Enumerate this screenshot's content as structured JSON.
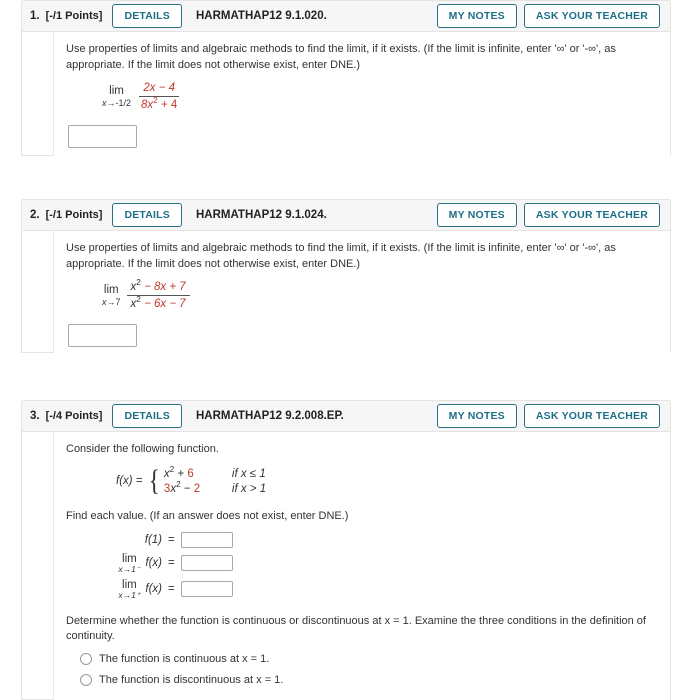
{
  "accent_color": "#1d6f87",
  "math_highlight_color": "#c0392b",
  "header_bg": "#f6f6f6",
  "buttons": {
    "details": "DETAILS",
    "my_notes": "MY NOTES",
    "ask_your_teacher": "ASK YOUR TEACHER"
  },
  "questions": [
    {
      "number": "1.",
      "points": "[-/1 Points]",
      "code": "HARMATHAP12 9.1.020.",
      "prompt": "Use properties of limits and algebraic methods to find the limit, if it exists. (If the limit is infinite, enter '∞' or '-∞', as appropriate. If the limit does not otherwise exist, enter DNE.)",
      "math": {
        "lim_label": "lim",
        "lim_sub_var": "x",
        "lim_sub_arrow": "→",
        "lim_sub_value": "-1/2",
        "numerator": "2x − 4",
        "denominator_base": "8x",
        "denominator_exp": "2",
        "denominator_rest": " + 4"
      },
      "answer_value": ""
    },
    {
      "number": "2.",
      "points": "[-/1 Points]",
      "code": "HARMATHAP12 9.1.024.",
      "prompt": "Use properties of limits and algebraic methods to find the limit, if it exists. (If the limit is infinite, enter '∞' or '-∞', as appropriate. If the limit does not otherwise exist, enter DNE.)",
      "math": {
        "lim_label": "lim",
        "lim_sub_var": "x",
        "lim_sub_arrow": "→",
        "lim_sub_value": "7",
        "num_base": "x",
        "num_exp": "2",
        "num_rest": " − 8x + 7",
        "den_base": "x",
        "den_exp": "2",
        "den_rest": " − 6x − 7"
      },
      "answer_value": ""
    },
    {
      "number": "3.",
      "points": "[-/4 Points]",
      "code": "HARMATHAP12 9.2.008.EP.",
      "prompt": "Consider the following function.",
      "piecewise": {
        "fx": "f(x)  =",
        "case1_expr_base": "x",
        "case1_expr_exp": "2",
        "case1_expr_rest": " + ",
        "case1_expr_red": "6",
        "case1_cond": "if x ≤ 1",
        "case2_coef": "3",
        "case2_base": "x",
        "case2_exp": "2",
        "case2_minus": " − ",
        "case2_const": "2",
        "case2_cond": "if x > 1"
      },
      "find_prompt": "Find each value. (If an answer does not exist, enter DNE.)",
      "value_rows": [
        {
          "label_type": "plain",
          "label": "f(1)",
          "value": ""
        },
        {
          "label_type": "limit",
          "lim": "lim",
          "sub": "x→1⁻",
          "fn": "f(x)",
          "value": ""
        },
        {
          "label_type": "limit",
          "lim": "lim",
          "sub": "x→1⁺",
          "fn": "f(x)",
          "value": ""
        }
      ],
      "continuity_prompt": "Determine whether the function is continuous or discontinuous at x = 1. Examine the three conditions in the definition of continuity.",
      "options": [
        "The function is continuous at x = 1.",
        "The function is discontinuous at x = 1."
      ]
    }
  ]
}
